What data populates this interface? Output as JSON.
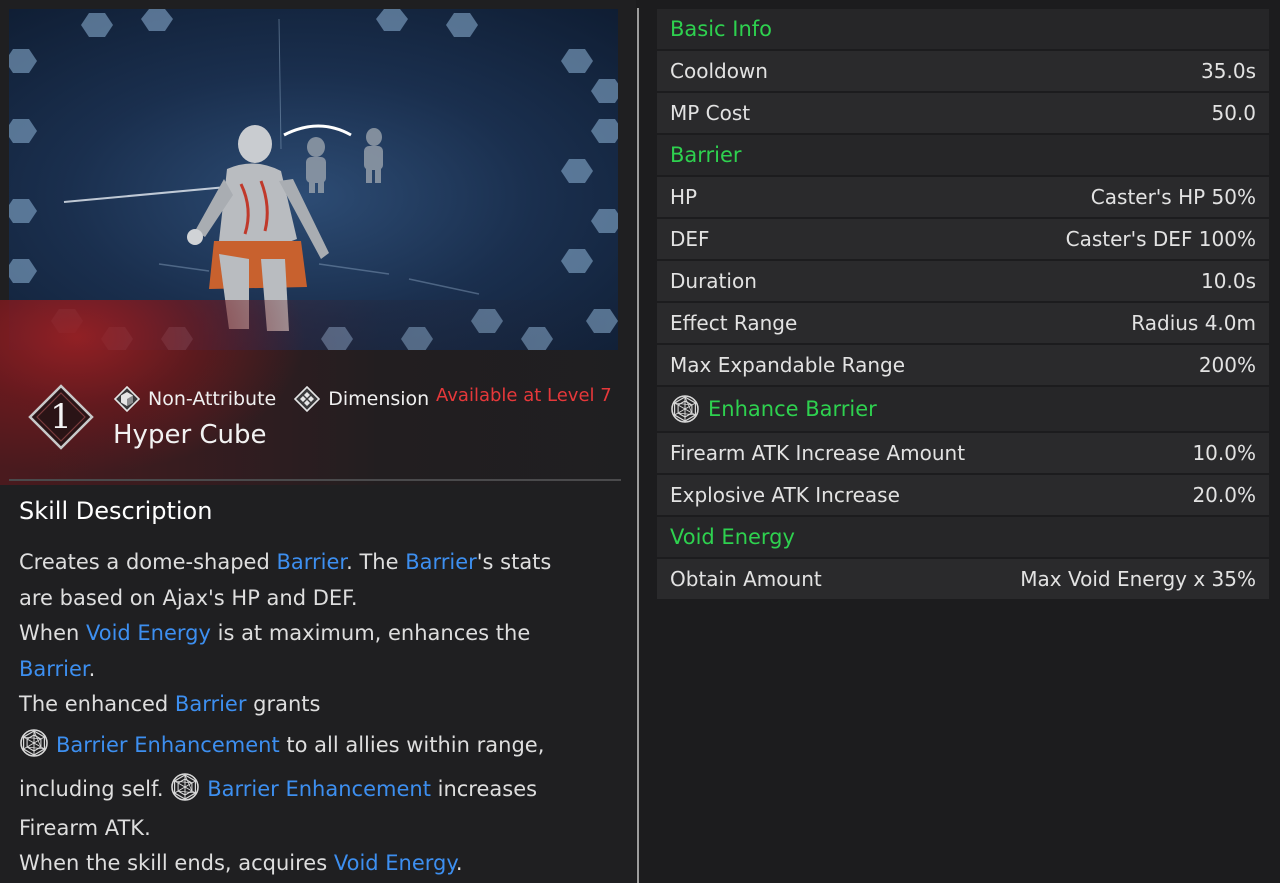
{
  "skill": {
    "level_number": "1",
    "attribute_label": "Non-Attribute",
    "type_label": "Dimension",
    "availability": "Available at Level 7",
    "name": "Hyper Cube"
  },
  "description": {
    "title": "Skill Description",
    "segments": {
      "l1a": "Creates a dome-shaped ",
      "l1b": "Barrier",
      "l1c": ". The ",
      "l1d": "Barrier",
      "l1e": "'s stats",
      "l2": "are based on Ajax's HP and DEF.",
      "l3a": "When ",
      "l3b": "Void Energy",
      "l3c": " is at maximum, enhances the",
      "l4a": "Barrier",
      "l4b": ".",
      "l5a": "The enhanced ",
      "l5b": "Barrier",
      "l5c": " grants",
      "l6a": "Barrier Enhancement",
      "l6b": " to all allies within range,",
      "l7a": "including self. ",
      "l7b": "Barrier Enhancement",
      "l7c": " increases",
      "l8": "Firearm ATK.",
      "l9a": "When the skill ends, acquires ",
      "l9b": "Void Energy",
      "l9c": "."
    }
  },
  "stats": {
    "basic_info": {
      "title": "Basic Info",
      "rows": [
        {
          "label": "Cooldown",
          "value": "35.0s"
        },
        {
          "label": "MP Cost",
          "value": "50.0"
        }
      ]
    },
    "barrier": {
      "title": "Barrier",
      "rows": [
        {
          "label": "HP",
          "value": "Caster's HP 50%"
        },
        {
          "label": "DEF",
          "value": "Caster's DEF 100%"
        },
        {
          "label": "Duration",
          "value": "10.0s"
        },
        {
          "label": "Effect Range",
          "value": "Radius 4.0m"
        },
        {
          "label": "Max Expandable Range",
          "value": "200%"
        }
      ]
    },
    "enhance_barrier": {
      "title": "Enhance Barrier",
      "rows": [
        {
          "label": "Firearm ATK Increase Amount",
          "value": "10.0%"
        },
        {
          "label": "Explosive ATK Increase",
          "value": "20.0%"
        }
      ]
    },
    "void_energy": {
      "title": "Void Energy",
      "rows": [
        {
          "label": "Obtain Amount",
          "value": "Max Void Energy x 35%"
        }
      ]
    }
  },
  "colors": {
    "section_header": "#2ed14f",
    "keyword": "#3d8ff0",
    "availability": "#e6383a",
    "row_background": "#2a2a2c"
  },
  "icons": {
    "attribute": "non-attribute-cube-icon",
    "type": "dimension-diamond-icon",
    "enhancement": "barrier-enhancement-web-icon"
  }
}
